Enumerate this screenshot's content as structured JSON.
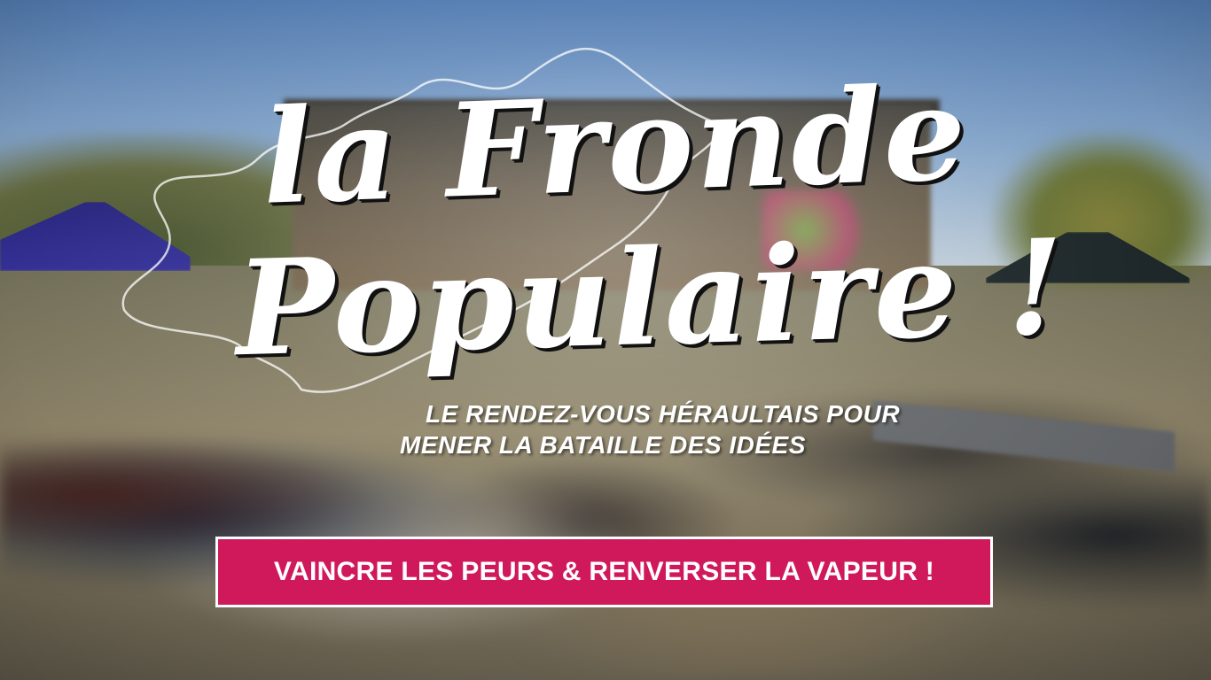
{
  "banner": {
    "title_line_1": "la Fronde",
    "title_line_2": "Populaire !",
    "subtitle_line_1": "LE RENDEZ-VOUS HÉRAULTAIS POUR",
    "subtitle_line_2": "MENER LA BATAILLE DES IDÉES",
    "cta_text": "VAINCRE LES PEURS & RENVERSER LA VAPEUR !"
  },
  "colors": {
    "cta_background": "#d0195a",
    "cta_border": "#ffffff",
    "title_fill": "#ffffff",
    "title_shadow": "#111111"
  },
  "background": {
    "description_icon": "outdoor-festival-crowd-photo",
    "outline_icon": "herault-region-outline-icon"
  }
}
